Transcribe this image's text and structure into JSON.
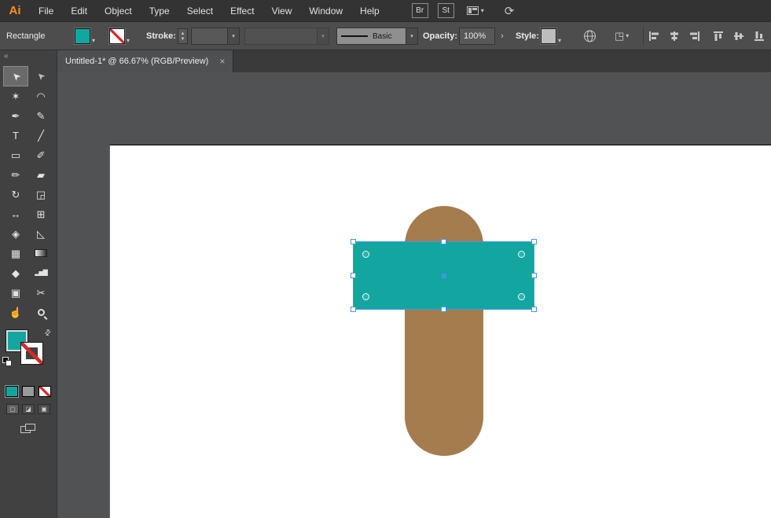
{
  "colors": {
    "teal": "#13a6a0",
    "brown": "#a57c4e",
    "selection": "#4496e8"
  },
  "icons": {
    "chevron_down": "▾",
    "right_chevron": "›",
    "stepper_up": "▲",
    "stepper_down": "▼",
    "close": "×",
    "collapse": "«",
    "swap": "⇄",
    "touch": "⟳",
    "transform": "◳",
    "draw_normal": "▢",
    "draw_behind": "◪",
    "draw_inside": "▣"
  },
  "menubar": {
    "logo": "Ai",
    "items": [
      "File",
      "Edit",
      "Object",
      "Type",
      "Select",
      "Effect",
      "View",
      "Window",
      "Help"
    ],
    "br_label": "Br",
    "st_label": "St"
  },
  "controlbar": {
    "context_label": "Rectangle",
    "stroke_label": "Stroke:",
    "stroke_weight_value": "",
    "profile_value": "",
    "brush_name": "Basic",
    "opacity_label": "Opacity:",
    "opacity_value": "100%",
    "style_label": "Style:"
  },
  "tab": {
    "title": "Untitled-1* @ 66.67% (RGB/Preview)"
  },
  "tools": [
    {
      "name": "Selection Tool",
      "glyph": "➤"
    },
    {
      "name": "Direct Selection Tool",
      "glyph": "➤"
    },
    {
      "name": "Magic Wand Tool",
      "glyph": "✶"
    },
    {
      "name": "Lasso Tool",
      "glyph": "◠"
    },
    {
      "name": "Pen Tool",
      "glyph": "✒"
    },
    {
      "name": "Curvature Tool",
      "glyph": "✎"
    },
    {
      "name": "Type Tool",
      "glyph": "T"
    },
    {
      "name": "Line Segment Tool",
      "glyph": "╱"
    },
    {
      "name": "Rectangle Tool",
      "glyph": "▭"
    },
    {
      "name": "Paintbrush Tool",
      "glyph": "✐"
    },
    {
      "name": "Shaper Tool",
      "glyph": "✏"
    },
    {
      "name": "Eraser Tool",
      "glyph": "▰"
    },
    {
      "name": "Rotate Tool",
      "glyph": "↻"
    },
    {
      "name": "Scale Tool",
      "glyph": "◲"
    },
    {
      "name": "Width Tool",
      "glyph": "↔"
    },
    {
      "name": "Free Transform Tool",
      "glyph": "⊞"
    },
    {
      "name": "Shape Builder Tool",
      "glyph": "◈"
    },
    {
      "name": "Perspective Grid Tool",
      "glyph": "◺"
    },
    {
      "name": "Mesh Tool",
      "glyph": "▦"
    },
    {
      "name": "Gradient Tool",
      "glyph": ""
    },
    {
      "name": "Eyedropper Tool",
      "glyph": "◆"
    },
    {
      "name": "Column Graph Tool",
      "glyph": "▂▅▇"
    },
    {
      "name": "Artboard Tool",
      "glyph": "▣"
    },
    {
      "name": "Slice Tool",
      "glyph": "✂"
    },
    {
      "name": "Hand Tool",
      "glyph": "☝"
    },
    {
      "name": "Zoom Tool",
      "glyph": ""
    }
  ]
}
